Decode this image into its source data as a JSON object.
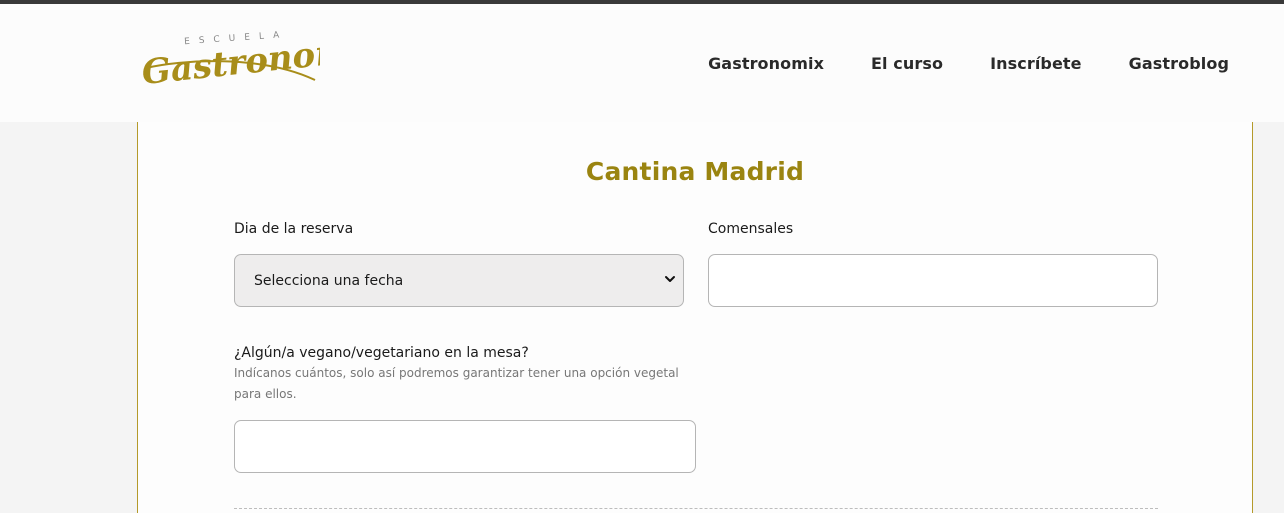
{
  "header": {
    "logo": {
      "top_text": "ESCUELA",
      "main_text": "Gastronomía"
    },
    "nav": [
      {
        "label": "Gastronomix"
      },
      {
        "label": "El curso"
      },
      {
        "label": "Inscríbete"
      },
      {
        "label": "Gastroblog"
      }
    ]
  },
  "form": {
    "title": "Cantina Madrid",
    "date_field": {
      "label": "Dia de la reserva",
      "selected": "Selecciona una fecha"
    },
    "guests_field": {
      "label": "Comensales",
      "value": ""
    },
    "vegan_field": {
      "label": "¿Algún/a vegano/vegetariano en la mesa?",
      "help": "Indícanos cuántos, solo así podremos garantizar tener una opción vegetal para ellos.",
      "value": ""
    }
  },
  "colors": {
    "accent": "#9a8410",
    "border_gold": "#b49a2a",
    "top_bar": "#3a3a3a"
  }
}
